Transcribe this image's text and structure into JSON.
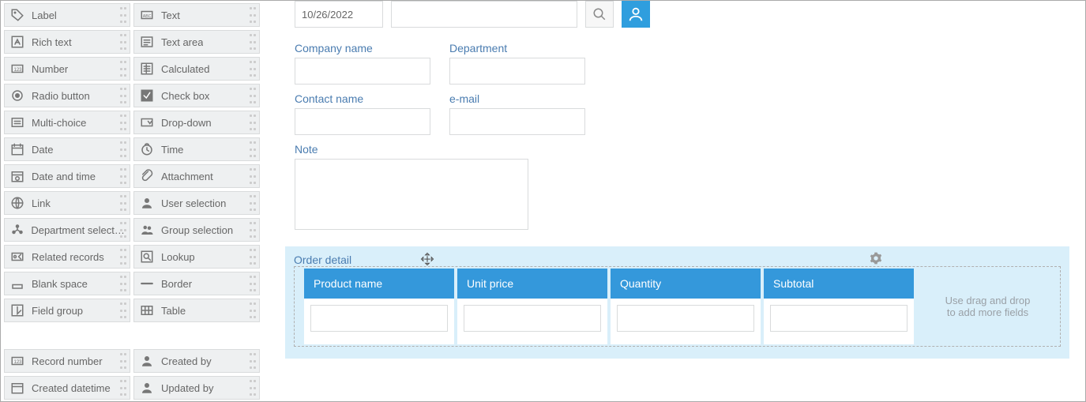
{
  "palette": {
    "col1": [
      {
        "icon": "tag",
        "label": "Label"
      },
      {
        "icon": "richtext",
        "label": "Rich text"
      },
      {
        "icon": "number",
        "label": "Number"
      },
      {
        "icon": "radio",
        "label": "Radio button"
      },
      {
        "icon": "multichoice",
        "label": "Multi-choice"
      },
      {
        "icon": "date",
        "label": "Date"
      },
      {
        "icon": "datetime",
        "label": "Date and time"
      },
      {
        "icon": "link",
        "label": "Link"
      },
      {
        "icon": "deptselect",
        "label": "Department selection"
      },
      {
        "icon": "related",
        "label": "Related records"
      },
      {
        "icon": "blank",
        "label": "Blank space"
      },
      {
        "icon": "fieldgroup",
        "label": "Field group"
      }
    ],
    "col2": [
      {
        "icon": "text",
        "label": "Text"
      },
      {
        "icon": "textarea",
        "label": "Text area"
      },
      {
        "icon": "calculated",
        "label": "Calculated"
      },
      {
        "icon": "checkbox",
        "label": "Check box"
      },
      {
        "icon": "dropdown",
        "label": "Drop-down"
      },
      {
        "icon": "time",
        "label": "Time"
      },
      {
        "icon": "attachment",
        "label": "Attachment"
      },
      {
        "icon": "userselect",
        "label": "User selection"
      },
      {
        "icon": "groupselect",
        "label": "Group selection"
      },
      {
        "icon": "lookup",
        "label": "Lookup"
      },
      {
        "icon": "border",
        "label": "Border"
      },
      {
        "icon": "table",
        "label": "Table"
      }
    ],
    "meta1": [
      {
        "icon": "recordnum",
        "label": "Record number"
      },
      {
        "icon": "createddate",
        "label": "Created datetime"
      }
    ],
    "meta2": [
      {
        "icon": "createdby",
        "label": "Created by"
      },
      {
        "icon": "updatedby",
        "label": "Updated by"
      }
    ]
  },
  "form": {
    "date_value": "10/26/2022",
    "company_label": "Company name",
    "department_label": "Department",
    "contact_label": "Contact name",
    "email_label": "e-mail",
    "note_label": "Note"
  },
  "table": {
    "title": "Order detail",
    "cols": [
      "Product name",
      "Unit price",
      "Quantity",
      "Subtotal"
    ],
    "hint_line1": "Use drag and drop",
    "hint_line2": "to add more fields"
  }
}
